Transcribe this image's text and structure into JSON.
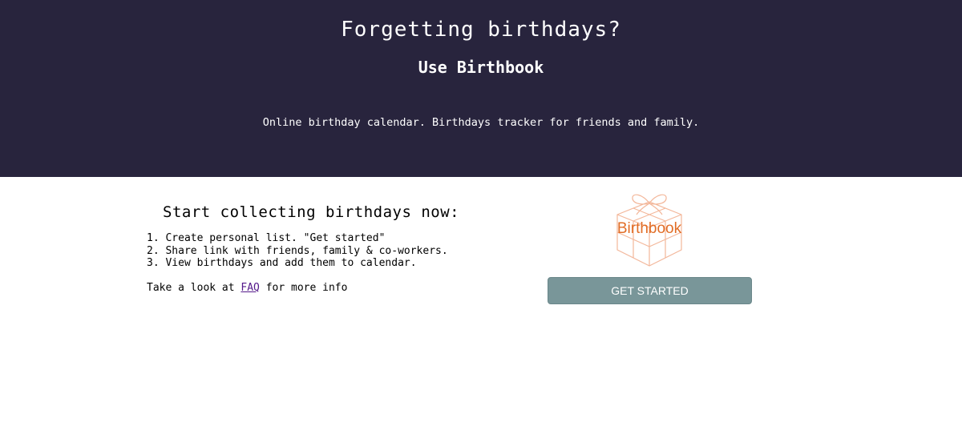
{
  "hero": {
    "title": "Forgetting birthdays?",
    "subtitle": "Use Birthbook",
    "description": "Online birthday calendar. Birthdays tracker for friends and family."
  },
  "main": {
    "heading": "Start collecting birthdays now:",
    "steps": [
      "1. Create personal list. \"Get started\"",
      "2. Share link with friends, family & co-workers.",
      "3. View birthdays and add them to calendar."
    ],
    "more_info": {
      "prefix": "Take a look at ",
      "link": "FAQ",
      "suffix": " for more info"
    }
  },
  "logo": {
    "text": "Birthbook",
    "icon": "gift-box-icon",
    "color": "#e16d26"
  },
  "cta": {
    "label": "GET STARTED",
    "color": "#799699"
  },
  "colors": {
    "hero_bg": "#28243d",
    "link": "#551a8b"
  }
}
